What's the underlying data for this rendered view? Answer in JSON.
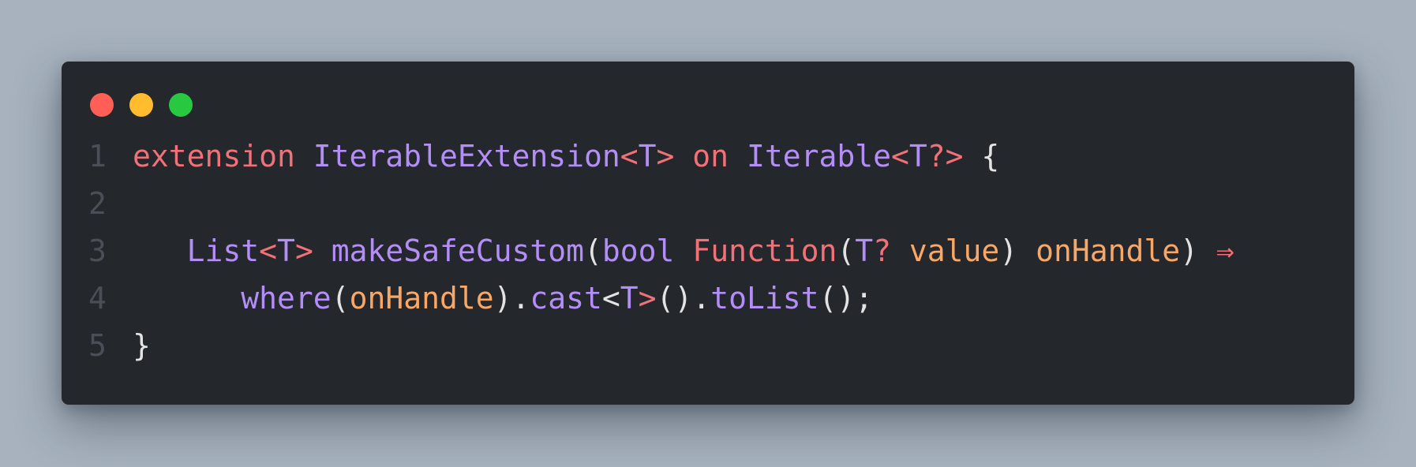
{
  "colors": {
    "background": "#a7b2be",
    "window": "#24272c",
    "keyword": "#f07178",
    "type": "#b48ef7",
    "parameter": "#f8a766",
    "punctuation": "#e3e3e3",
    "line_number": "#4a4f57",
    "close_dot": "#ff5f57",
    "minimize_dot": "#febc2e",
    "zoom_dot": "#28c840"
  },
  "window_controls": [
    {
      "name": "close",
      "icon": "red-dot-icon"
    },
    {
      "name": "minimize",
      "icon": "yellow-dot-icon"
    },
    {
      "name": "zoom",
      "icon": "green-dot-icon"
    }
  ],
  "code": {
    "line_numbers": [
      "1",
      "2",
      "3",
      "4",
      "5"
    ],
    "lines": [
      [
        {
          "t": "extension",
          "k": "kw"
        },
        {
          "t": " ",
          "k": "pu"
        },
        {
          "t": "IterableExtension",
          "k": "ty"
        },
        {
          "t": "<",
          "k": "gp"
        },
        {
          "t": "T",
          "k": "ty"
        },
        {
          "t": ">",
          "k": "gp"
        },
        {
          "t": " ",
          "k": "pu"
        },
        {
          "t": "on",
          "k": "kw"
        },
        {
          "t": " ",
          "k": "pu"
        },
        {
          "t": "Iterable",
          "k": "ty"
        },
        {
          "t": "<",
          "k": "gp"
        },
        {
          "t": "T",
          "k": "ty"
        },
        {
          "t": "?>",
          "k": "gp"
        },
        {
          "t": " {",
          "k": "pu"
        }
      ],
      [],
      [
        {
          "t": "   ",
          "k": "pu"
        },
        {
          "t": "List",
          "k": "ty"
        },
        {
          "t": "<",
          "k": "gp"
        },
        {
          "t": "T",
          "k": "ty"
        },
        {
          "t": ">",
          "k": "gp"
        },
        {
          "t": " ",
          "k": "pu"
        },
        {
          "t": "makeSafeCustom",
          "k": "fn"
        },
        {
          "t": "(",
          "k": "pu"
        },
        {
          "t": "bool",
          "k": "ty"
        },
        {
          "t": " ",
          "k": "pu"
        },
        {
          "t": "Function",
          "k": "kw"
        },
        {
          "t": "(",
          "k": "pu"
        },
        {
          "t": "T",
          "k": "ty"
        },
        {
          "t": "?",
          "k": "gp"
        },
        {
          "t": " ",
          "k": "pu"
        },
        {
          "t": "value",
          "k": "pa"
        },
        {
          "t": ") ",
          "k": "pu"
        },
        {
          "t": "onHandle",
          "k": "pa"
        },
        {
          "t": ") ",
          "k": "pu"
        },
        {
          "t": "⇒",
          "k": "kw"
        }
      ],
      [
        {
          "t": "      ",
          "k": "pu"
        },
        {
          "t": "where",
          "k": "fn"
        },
        {
          "t": "(",
          "k": "pu"
        },
        {
          "t": "onHandle",
          "k": "pa"
        },
        {
          "t": ").",
          "k": "pu"
        },
        {
          "t": "cast",
          "k": "fn"
        },
        {
          "t": "<",
          "k": "pu"
        },
        {
          "t": "T",
          "k": "ty"
        },
        {
          "t": ">",
          "k": "gp"
        },
        {
          "t": "().",
          "k": "pu"
        },
        {
          "t": "toList",
          "k": "fn"
        },
        {
          "t": "();",
          "k": "pu"
        }
      ],
      [
        {
          "t": "}",
          "k": "pu"
        }
      ]
    ]
  }
}
